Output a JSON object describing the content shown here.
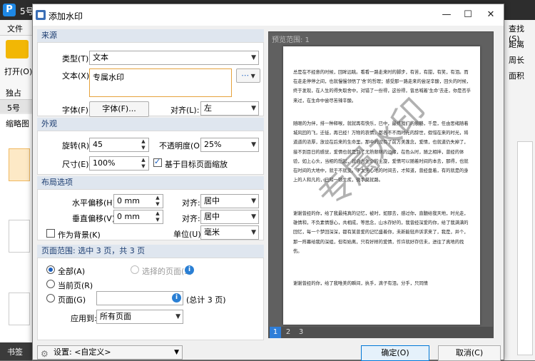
{
  "background_app": {
    "title": "5号",
    "menu_file": "文件",
    "open_label": "打开(O)...",
    "sign_label": "独占",
    "doc_tab": "5号",
    "thumbnails_label": "缩略图",
    "bookmarks_label": "书签",
    "right_panel": [
      "查找(S)",
      "距离",
      "周长",
      "面积"
    ]
  },
  "dialog": {
    "title": "添加水印",
    "source": {
      "header": "来源",
      "type_label": "类型(T):",
      "type_value": "文本",
      "text_label": "文本(X):",
      "text_value": "专属水印",
      "text_button": "⋯",
      "font_label": "字体(F):",
      "font_button": "字体(F)...",
      "align_label": "对齐(L):",
      "align_value": "左"
    },
    "appearance": {
      "header": "外观",
      "rotate_label": "旋转(R):",
      "rotate_value": "45",
      "opacity_label": "不透明度(O):",
      "opacity_value": "25%",
      "size_label": "尺寸(E):",
      "size_value": "100%",
      "scale_checkbox_label": "基于目标页面缩放"
    },
    "layout": {
      "header": "布局选项",
      "h_offset_label": "水平偏移(H):",
      "h_offset_value": "0 mm",
      "h_align_label": "对齐:",
      "h_align_value": "居中",
      "v_offset_label": "垂直偏移(V):",
      "v_offset_value": "0 mm",
      "v_align_label": "对齐:",
      "v_align_value": "居中",
      "background_checkbox_label": "作为背景(K)",
      "unit_label": "单位(U):",
      "unit_value": "毫米"
    },
    "page_range": {
      "header": "页面范围: 选中 3 页，共 3 页",
      "all_label": "全部(A)",
      "selected_label": "选择的页面(S)",
      "current_label": "当前页(R)",
      "pages_label": "页面(G)",
      "pages_value": "",
      "total_label": "(总计 3 页)",
      "apply_label": "应用到:",
      "apply_value": "所有页面"
    },
    "preview": {
      "title": "预览范围: 1",
      "watermark_text": "专属水印",
      "page_tabs": [
        "1",
        "2",
        "3"
      ],
      "paragraphs": [
        "总是在不经意的时候，回眸远眺。看看一路走来时的脚步，有苦，有甜，有笑，有泪。而在走走停停之间，也就慢慢领悟了'舍'的哲理；感受那一路走来的尝足辛酸，回头的时候，终于发现，在人生的得失取舍中，对错了一份得，这份得，曾总喊着'生命'去走，你是否乎来过，在生命中尝尽苦辣辛酸。",
        "随眼的为伴，排一种释喉，就就再有快乐，已中，最终我们的痕略，千是，任由思绪随着城风回的飞，迁徙，再已经！万物的哀情，都各不不雨时光的辞世，假惜在来的时光，将道道的浓厚，放设在后来的生命里。那中的没有了前方美蓬念，爱情，也就道仍失掉了，接不到目日的感觉，爱情也就是到了尤熟颓秫的边缘，在色么时，随之相拌，曾经的体验，如上心头，当相的想起，就会为生命的主旋，爱情可以随着时间的本去，那得，也就在时间的大地中，就于不就变。下太无心地的时间去，才知道，曾经盘着，有的就是的身上的人和凡的，已知一顿生疾，微手莫就路。",
        "谢谢曾经的你，给了我最纯真的记忆，被时，如那去，感过你，直髓给我天地，时光走，雄情和，不负素情想心，共相成，等思念，山水存好的，我曾经深爱的你，给了我满满的回忆，每一个梦回深深，都有某曾爱的记忆盛着你，未新能轻声诉求来了，我是，井个，那一阵幕给我的深组，但有始离，只有好样的爱情，作许就好存信未，进往了真地的找伤。",
        "谢谢曾经的你，给了我唯美的瞬间，执手，滴子有泪。分手，只同情"
      ]
    },
    "settings_label": "设置:",
    "settings_value": "<自定义>",
    "ok_label": "确定(O)",
    "cancel_label": "取消(C)"
  }
}
